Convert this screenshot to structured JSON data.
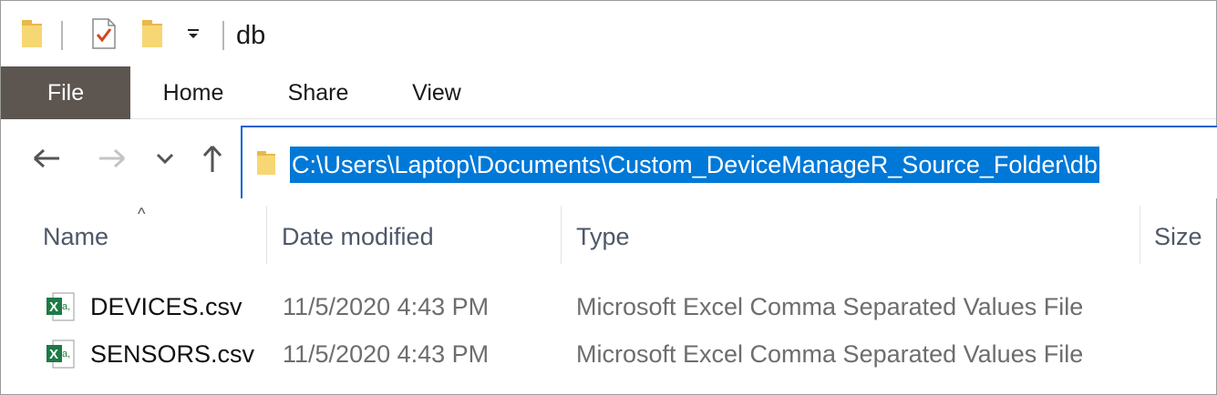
{
  "window": {
    "title": "db"
  },
  "quick_access": {
    "icons": [
      "folder-icon",
      "properties-checkmark-icon",
      "new-folder-icon",
      "customize-dropdown-icon"
    ]
  },
  "ribbon": {
    "tabs": [
      {
        "label": "File"
      },
      {
        "label": "Home"
      },
      {
        "label": "Share"
      },
      {
        "label": "View"
      }
    ],
    "file_bg": "#5c5550"
  },
  "navigation": {
    "back_icon": "arrow-left-icon",
    "forward_icon": "arrow-right-icon",
    "recent_icon": "chevron-down-icon",
    "up_icon": "arrow-up-icon",
    "address": "C:\\Users\\Laptop\\Documents\\Custom_DeviceManageR_Source_Folder\\db",
    "selection_color": "#0078d7"
  },
  "columns": {
    "name": "Name",
    "date": "Date modified",
    "type": "Type",
    "size": "Size",
    "sort_indicator": "^"
  },
  "files": [
    {
      "name": "DEVICES.csv",
      "date": "11/5/2020 4:43 PM",
      "type": "Microsoft Excel Comma Separated Values File",
      "icon": "excel-csv-icon"
    },
    {
      "name": "SENSORS.csv",
      "date": "11/5/2020 4:43 PM",
      "type": "Microsoft Excel Comma Separated Values File",
      "icon": "excel-csv-icon"
    }
  ]
}
